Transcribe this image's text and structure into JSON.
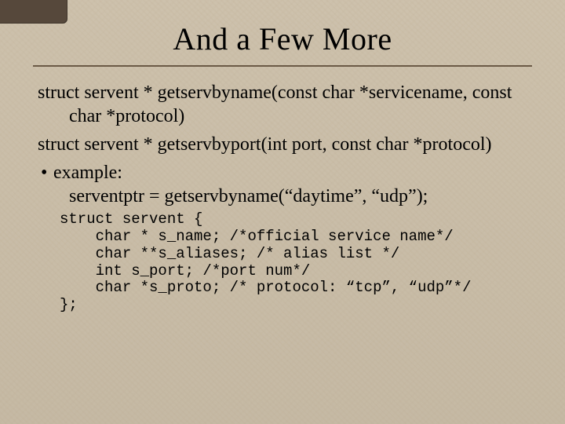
{
  "slide": {
    "title": "And a Few More",
    "decl1": "struct servent * getservbyname(const char *servicename, const char *protocol)",
    "decl2": "struct servent * getservbyport(int port, const char *protocol)",
    "bullet_label": "example:",
    "example_call": "serventptr = getservbyname(“daytime”, “udp”);",
    "struct_code": "struct servent {\n    char * s_name; /*official service name*/\n    char **s_aliases; /* alias list */\n    int s_port; /*port num*/\n    char *s_proto; /* protocol: “tcp”, “udp”*/\n};"
  }
}
